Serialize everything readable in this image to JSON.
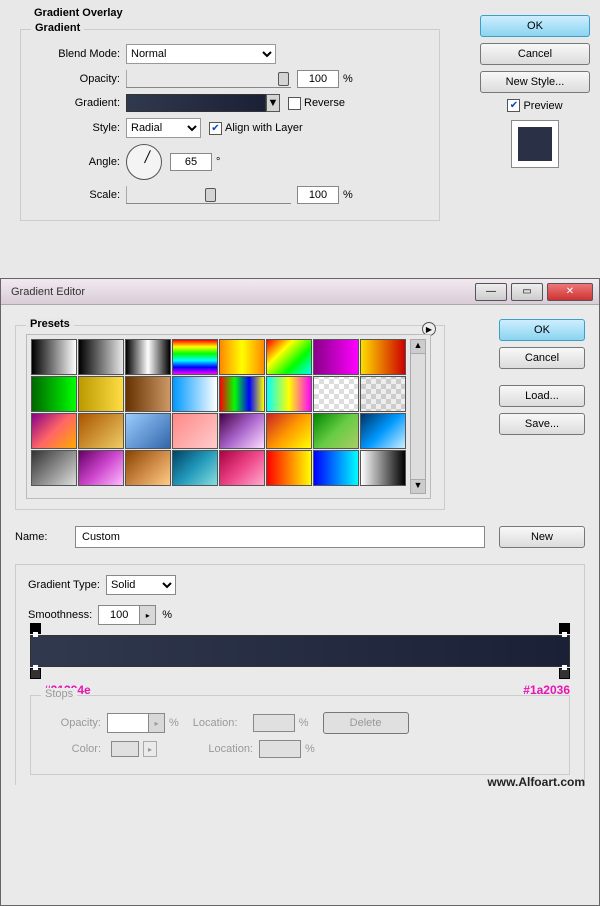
{
  "overlay": {
    "title": "Gradient Overlay",
    "gradient_title": "Gradient",
    "labels": {
      "blend_mode": "Blend Mode:",
      "opacity": "Opacity:",
      "gradient": "Gradient:",
      "style": "Style:",
      "angle": "Angle:",
      "scale": "Scale:"
    },
    "blend_mode_value": "Normal",
    "opacity_value": "100",
    "percent": "%",
    "reverse_label": "Reverse",
    "reverse_checked": false,
    "style_value": "Radial",
    "align_label": "Align with Layer",
    "align_checked": true,
    "angle_value": "65",
    "degree": "°",
    "scale_value": "100",
    "buttons": {
      "ok": "OK",
      "cancel": "Cancel",
      "new_style": "New Style..."
    },
    "preview_label": "Preview",
    "preview_checked": true
  },
  "editor": {
    "title": "Gradient Editor",
    "presets_title": "Presets",
    "buttons": {
      "ok": "OK",
      "cancel": "Cancel",
      "load": "Load...",
      "save": "Save...",
      "new": "New",
      "delete": "Delete"
    },
    "name_label": "Name:",
    "name_value": "Custom",
    "gradient_type_label": "Gradient Type:",
    "gradient_type_value": "Solid",
    "smoothness_label": "Smoothness:",
    "smoothness_value": "100",
    "percent": "%",
    "hex_left": "#31394e",
    "hex_right": "#1a2036",
    "stops": {
      "title": "Stops",
      "opacity_label": "Opacity:",
      "location_label": "Location:",
      "color_label": "Color:"
    }
  },
  "watermark": "www.Alfoart.com",
  "presets": [
    "linear-gradient(to right,#000,#fff)",
    "linear-gradient(to right,#000,transparent)",
    "linear-gradient(to right,#000,#fff,#000)",
    "linear-gradient(to bottom,#f00,#ff0,#0f0,#0ff,#00f,#f0f)",
    "linear-gradient(to right,#f80,#ff0,#f80)",
    "linear-gradient(135deg,#f00,#ff0,#0f0,#0ff)",
    "linear-gradient(to right,#808,#f0f)",
    "linear-gradient(to right,#fd0,#c00)",
    "linear-gradient(to right,#060,#0f0)",
    "linear-gradient(to right,#b90,#fd4)",
    "linear-gradient(to right,#630,#c96)",
    "linear-gradient(to right,#09f,#fff)",
    "linear-gradient(to right,#f00,#0f0,#00f,#ff0)",
    "linear-gradient(to right,#0ff,#ff0,#f0f)",
    "repeating-conic-gradient(#ddd 0 25%,#fff 0 50%) 0/10px 10px",
    "repeating-conic-gradient(#ccc 0 25%,#eee 0 50%) 0/10px 10px",
    "linear-gradient(135deg,#808,#f66,#fa0)",
    "linear-gradient(135deg,#a50,#ec6)",
    "linear-gradient(135deg,#9cf,#36a)",
    "linear-gradient(135deg,#f88,#fcc)",
    "linear-gradient(135deg,#404,#a6c,#fdf)",
    "linear-gradient(135deg,#c22,#f90,#ff0)",
    "linear-gradient(135deg,#080,#6c4,#ac6)",
    "linear-gradient(135deg,#036,#09f,#cef)",
    "linear-gradient(135deg,#333,#888,#ddd)",
    "linear-gradient(135deg,#606,#c4c,#fbf)",
    "linear-gradient(135deg,#840,#c84,#fc8)",
    "linear-gradient(135deg,#046,#29b,#8dd)",
    "linear-gradient(135deg,#a04,#e48,#fac)",
    "linear-gradient(to right,#f00,#ff0)",
    "linear-gradient(to right,#00f,#0ff)",
    "linear-gradient(to right,#fff,#000)"
  ]
}
